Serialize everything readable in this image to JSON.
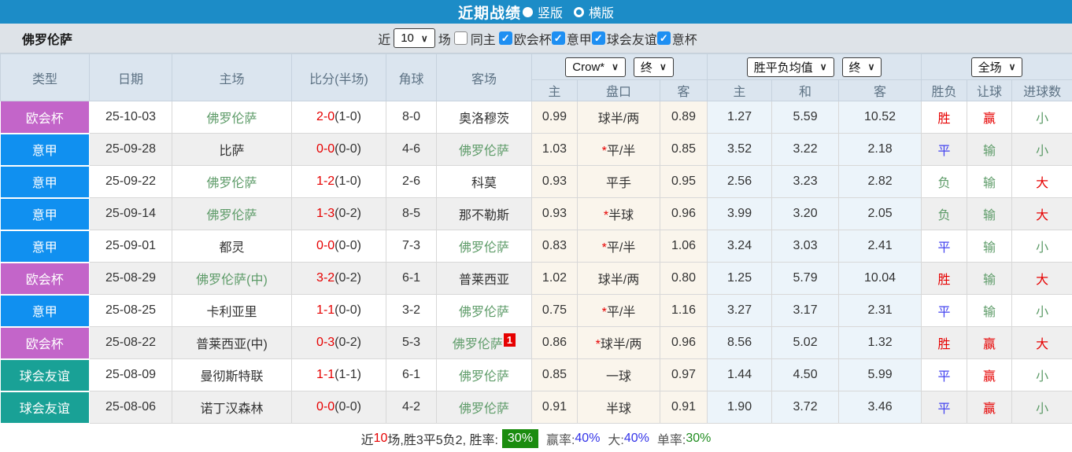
{
  "topbar": {
    "title": "近期战绩",
    "radio_vertical_label": "竖版",
    "radio_horizontal_label": "横版",
    "selected_layout": "竖版"
  },
  "filterbar": {
    "team": "佛罗伦萨",
    "recent_label": "近",
    "recent_value": "10",
    "games_label": "场",
    "same_home_label": "同主",
    "same_home_checked": false,
    "competitions": [
      {
        "label": "欧会杯",
        "checked": true
      },
      {
        "label": "意甲",
        "checked": true
      },
      {
        "label": "球会友谊",
        "checked": true
      },
      {
        "label": "意杯",
        "checked": true
      }
    ]
  },
  "table": {
    "columns": [
      "类型",
      "日期",
      "主场",
      "比分(半场)",
      "角球",
      "客场",
      "主",
      "盘口",
      "客",
      "主",
      "和",
      "客",
      "胜负",
      "让球",
      "进球数"
    ],
    "selects": {
      "bookmaker": "Crow*",
      "bookmaker_time": "终",
      "avg": "胜平负均值",
      "avg_time": "终",
      "period": "全场"
    },
    "rows": [
      {
        "type": "欧会杯",
        "date": "25-10-03",
        "home": "佛罗伦萨",
        "home_team": true,
        "score": "2-0",
        "half": "(1-0)",
        "corners": "8-0",
        "away": "奥洛穆茨",
        "away_team": false,
        "away_badge": "",
        "odds_home": "0.99",
        "handicap": "球半/两",
        "odds_away": "0.89",
        "avg_home": "1.27",
        "avg_draw": "5.59",
        "avg_away": "10.52",
        "wdl": "胜",
        "ah": "赢",
        "ou": "小"
      },
      {
        "type": "意甲",
        "date": "25-09-28",
        "home": "比萨",
        "home_team": false,
        "score": "0-0",
        "half": "(0-0)",
        "corners": "4-6",
        "away": "佛罗伦萨",
        "away_team": true,
        "away_badge": "",
        "odds_home": "1.03",
        "handicap": "*平/半",
        "odds_away": "0.85",
        "avg_home": "3.52",
        "avg_draw": "3.22",
        "avg_away": "2.18",
        "wdl": "平",
        "ah": "输",
        "ou": "小"
      },
      {
        "type": "意甲",
        "date": "25-09-22",
        "home": "佛罗伦萨",
        "home_team": true,
        "score": "1-2",
        "half": "(1-0)",
        "corners": "2-6",
        "away": "科莫",
        "away_team": false,
        "away_badge": "",
        "odds_home": "0.93",
        "handicap": "平手",
        "odds_away": "0.95",
        "avg_home": "2.56",
        "avg_draw": "3.23",
        "avg_away": "2.82",
        "wdl": "负",
        "ah": "输",
        "ou": "大"
      },
      {
        "type": "意甲",
        "date": "25-09-14",
        "home": "佛罗伦萨",
        "home_team": true,
        "score": "1-3",
        "half": "(0-2)",
        "corners": "8-5",
        "away": "那不勒斯",
        "away_team": false,
        "away_badge": "",
        "odds_home": "0.93",
        "handicap": "*半球",
        "odds_away": "0.96",
        "avg_home": "3.99",
        "avg_draw": "3.20",
        "avg_away": "2.05",
        "wdl": "负",
        "ah": "输",
        "ou": "大"
      },
      {
        "type": "意甲",
        "date": "25-09-01",
        "home": "都灵",
        "home_team": false,
        "score": "0-0",
        "half": "(0-0)",
        "corners": "7-3",
        "away": "佛罗伦萨",
        "away_team": true,
        "away_badge": "",
        "odds_home": "0.83",
        "handicap": "*平/半",
        "odds_away": "1.06",
        "avg_home": "3.24",
        "avg_draw": "3.03",
        "avg_away": "2.41",
        "wdl": "平",
        "ah": "输",
        "ou": "小"
      },
      {
        "type": "欧会杯",
        "date": "25-08-29",
        "home": "佛罗伦萨(中)",
        "home_team": true,
        "score": "3-2",
        "half": "(0-2)",
        "corners": "6-1",
        "away": "普莱西亚",
        "away_team": false,
        "away_badge": "",
        "odds_home": "1.02",
        "handicap": "球半/两",
        "odds_away": "0.80",
        "avg_home": "1.25",
        "avg_draw": "5.79",
        "avg_away": "10.04",
        "wdl": "胜",
        "ah": "输",
        "ou": "大"
      },
      {
        "type": "意甲",
        "date": "25-08-25",
        "home": "卡利亚里",
        "home_team": false,
        "score": "1-1",
        "half": "(0-0)",
        "corners": "3-2",
        "away": "佛罗伦萨",
        "away_team": true,
        "away_badge": "",
        "odds_home": "0.75",
        "handicap": "*平/半",
        "odds_away": "1.16",
        "avg_home": "3.27",
        "avg_draw": "3.17",
        "avg_away": "2.31",
        "wdl": "平",
        "ah": "输",
        "ou": "小"
      },
      {
        "type": "欧会杯",
        "date": "25-08-22",
        "home": "普莱西亚(中)",
        "home_team": false,
        "score": "0-3",
        "half": "(0-2)",
        "corners": "5-3",
        "away": "佛罗伦萨",
        "away_team": true,
        "away_badge": "1",
        "odds_home": "0.86",
        "handicap": "*球半/两",
        "odds_away": "0.96",
        "avg_home": "8.56",
        "avg_draw": "5.02",
        "avg_away": "1.32",
        "wdl": "胜",
        "ah": "赢",
        "ou": "大"
      },
      {
        "type": "球会友谊",
        "date": "25-08-09",
        "home": "曼彻斯特联",
        "home_team": false,
        "score": "1-1",
        "half": "(1-1)",
        "corners": "6-1",
        "away": "佛罗伦萨",
        "away_team": true,
        "away_badge": "",
        "odds_home": "0.85",
        "handicap": "一球",
        "odds_away": "0.97",
        "avg_home": "1.44",
        "avg_draw": "4.50",
        "avg_away": "5.99",
        "wdl": "平",
        "ah": "赢",
        "ou": "小"
      },
      {
        "type": "球会友谊",
        "date": "25-08-06",
        "home": "诺丁汉森林",
        "home_team": false,
        "score": "0-0",
        "half": "(0-0)",
        "corners": "4-2",
        "away": "佛罗伦萨",
        "away_team": true,
        "away_badge": "",
        "odds_home": "0.91",
        "handicap": "半球",
        "odds_away": "0.91",
        "avg_home": "1.90",
        "avg_draw": "3.72",
        "avg_away": "3.46",
        "wdl": "平",
        "ah": "赢",
        "ou": "小"
      }
    ]
  },
  "footer": {
    "prefix_1": "近",
    "games": "10",
    "prefix_2": "场,胜3平5负2, 胜率:",
    "win_rate": "30%",
    "ah_label": "赢率:",
    "ah_value": "40%",
    "ou_label": "大:",
    "ou_value": "40%",
    "single_label": "单率:",
    "single_value": "30%"
  },
  "colors": {
    "types": {
      "欧会杯": "#c365c9",
      "意甲": "#1090f0",
      "球会友谊": "#19a196"
    },
    "wdl": {
      "胜": "#e60000",
      "平": "#4343ef",
      "负": "#5d9b68"
    },
    "ah": {
      "赢": "#e60000",
      "输": "#5d9b68"
    },
    "ou": {
      "大": "#e60000",
      "小": "#5d9b68"
    }
  }
}
